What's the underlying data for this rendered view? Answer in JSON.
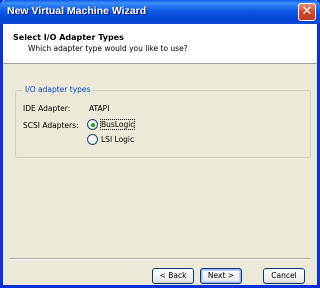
{
  "window": {
    "title": "New Virtual Machine Wizard",
    "close_glyph": "✕"
  },
  "header": {
    "title": "Select I/O Adapter Types",
    "subtitle": "Which adapter type would you like to use?"
  },
  "group": {
    "legend": "I/O adapter types",
    "ide_label": "IDE Adapter:",
    "ide_value": "ATAPI",
    "scsi_label": "SCSI Adapters:",
    "options": [
      {
        "label": "BusLogic",
        "selected": true
      },
      {
        "label": "LSI Logic",
        "selected": false
      }
    ]
  },
  "buttons": {
    "back": "< Back",
    "next": "Next >",
    "cancel": "Cancel"
  },
  "colors": {
    "titlebar": "#0a58ea",
    "legend": "#0046d5",
    "radio_dot": "#21a121",
    "face": "#ece9d8"
  },
  "icons": {
    "close": "close-icon"
  }
}
